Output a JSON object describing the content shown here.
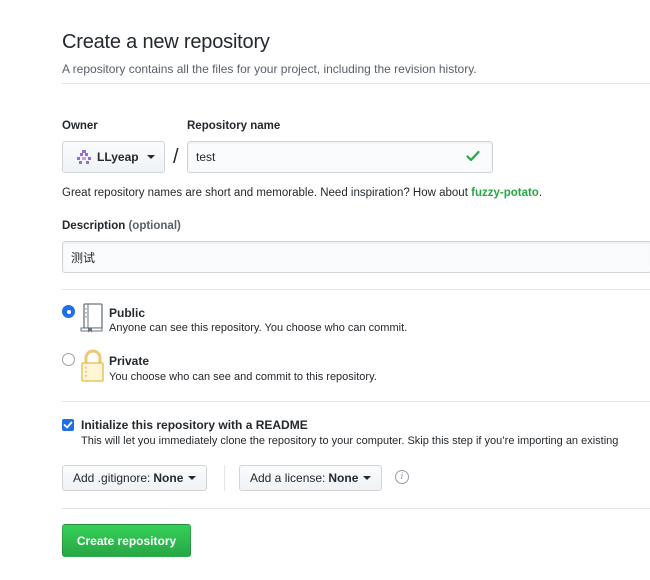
{
  "header": {
    "title": "Create a new repository",
    "subtitle": "A repository contains all the files for your project, including the revision history."
  },
  "owner": {
    "label": "Owner",
    "value": "LLyeap"
  },
  "slash": "/",
  "repository": {
    "label": "Repository name",
    "value": "test",
    "valid_icon": "check-icon"
  },
  "hint": {
    "text": "Great repository names are short and memorable. Need inspiration? How about ",
    "suggestion": "fuzzy-potato",
    "end": "."
  },
  "description": {
    "label": "Description",
    "optional": "(optional)",
    "value": "测试"
  },
  "visibility": {
    "public": {
      "title": "Public",
      "desc": "Anyone can see this repository. You choose who can commit.",
      "selected": true,
      "icon": "repo-book-icon"
    },
    "private": {
      "title": "Private",
      "desc": "You choose who can see and commit to this repository.",
      "selected": false,
      "icon": "lock-icon"
    }
  },
  "readme": {
    "checked": true,
    "title": "Initialize this repository with a README",
    "desc": "This will let you immediately clone the repository to your computer. Skip this step if you’re importing an existing"
  },
  "gitignore": {
    "prefix": "Add .gitignore:",
    "value": "None"
  },
  "license": {
    "prefix": "Add a license:",
    "value": "None"
  },
  "info_icon": "info-icon",
  "submit": {
    "label": "Create repository"
  },
  "colors": {
    "accent_blue": "#1f6feb",
    "success_green": "#28a745",
    "border": "#d1d5da"
  }
}
